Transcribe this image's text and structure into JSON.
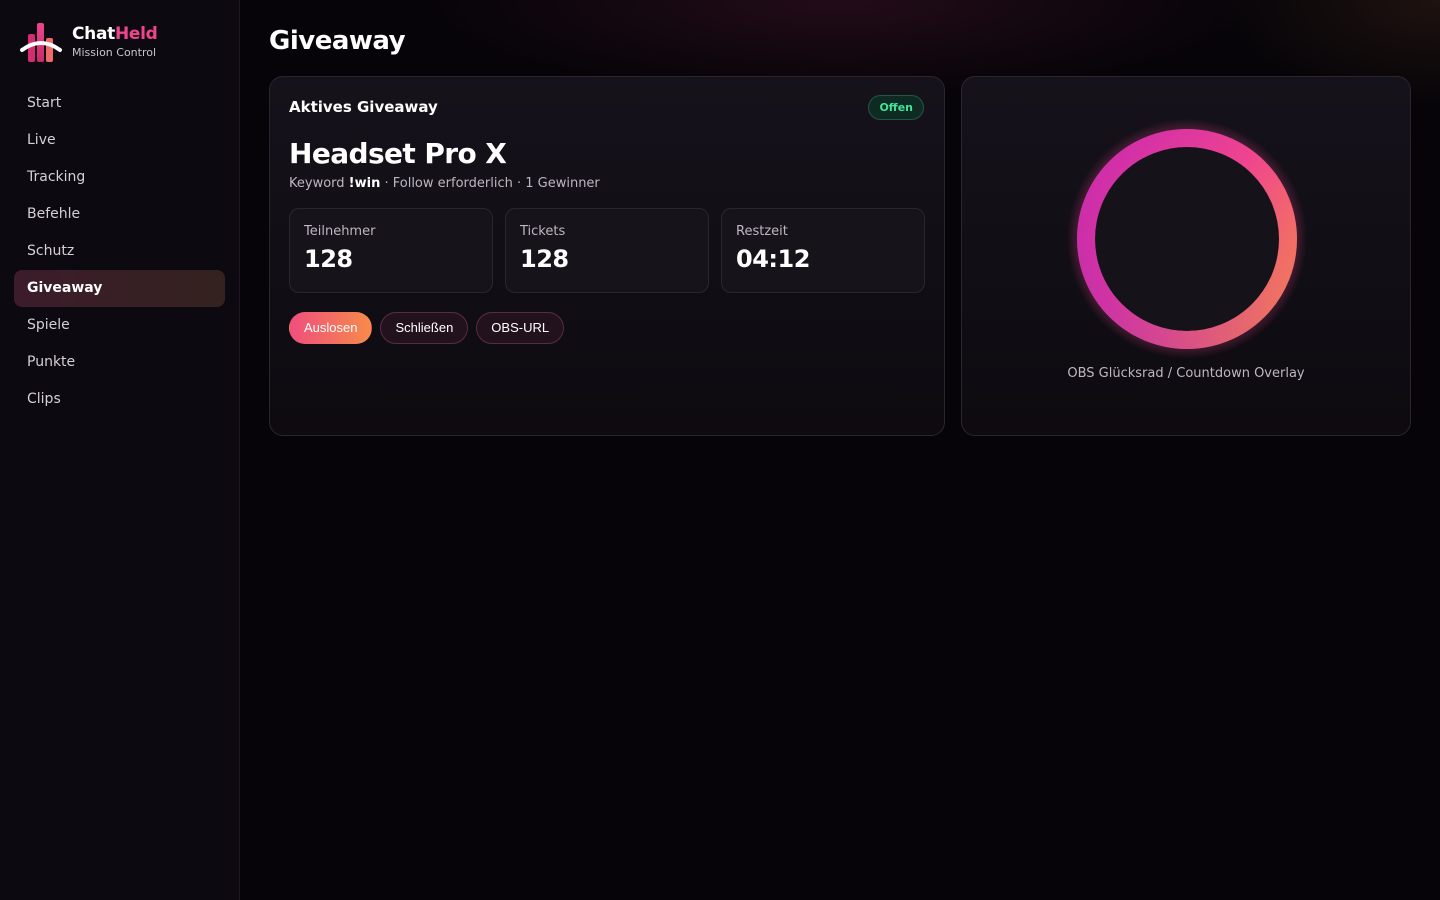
{
  "brand": {
    "name_part1": "Chat",
    "name_part2": "Held",
    "subtitle": "Mission Control",
    "logo_icon": "brand-logo-icon"
  },
  "nav": {
    "items": [
      {
        "label": "Start",
        "active": false
      },
      {
        "label": "Live",
        "active": false
      },
      {
        "label": "Tracking",
        "active": false
      },
      {
        "label": "Befehle",
        "active": false
      },
      {
        "label": "Schutz",
        "active": false
      },
      {
        "label": "Giveaway",
        "active": true
      },
      {
        "label": "Spiele",
        "active": false
      },
      {
        "label": "Punkte",
        "active": false
      },
      {
        "label": "Clips",
        "active": false
      }
    ]
  },
  "page": {
    "title": "Giveaway"
  },
  "giveaway": {
    "heading": "Aktives Giveaway",
    "status": "Offen",
    "prize": "Headset Pro X",
    "meta": {
      "keyword_label": "Keyword",
      "keyword": "!win",
      "rest": "· Follow erforderlich · 1 Gewinner"
    },
    "stats": [
      {
        "label": "Teilnehmer",
        "value": "128"
      },
      {
        "label": "Tickets",
        "value": "128"
      },
      {
        "label": "Restzeit",
        "value": "04:12"
      }
    ],
    "actions": {
      "draw_label": "Auslosen",
      "close_label": "Schließen",
      "obs_label": "OBS-URL"
    }
  },
  "overlay": {
    "caption": "OBS Glücksrad / Countdown Overlay",
    "ring_icon": "wheel-ring-icon"
  },
  "colors": {
    "accent_pink": "#f0458e",
    "accent_orange": "#f78a4a",
    "accent_purple": "#b01fb8",
    "status_green": "#3ee49a",
    "background": "#060408"
  }
}
